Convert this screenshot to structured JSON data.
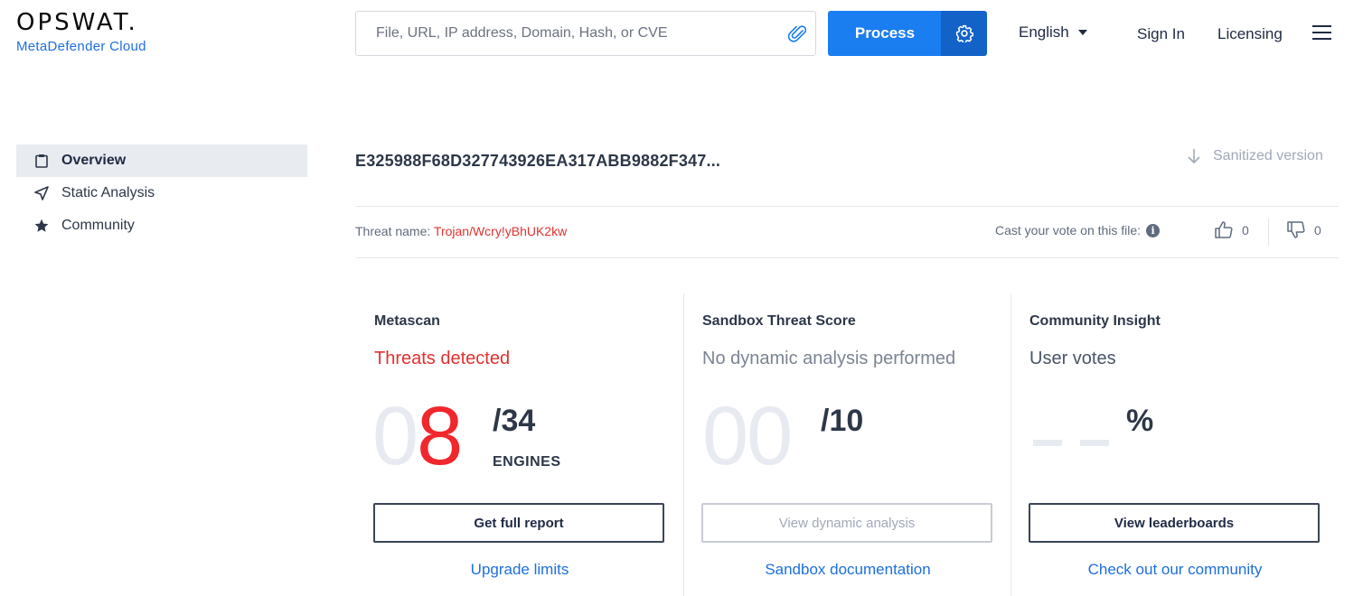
{
  "header": {
    "logo_text": "OPSWAT.",
    "logo_sub": "MetaDefender Cloud",
    "search_placeholder": "File, URL, IP address, Domain, Hash, or CVE",
    "process_label": "Process",
    "language": "English",
    "signin_label": "Sign In",
    "licensing_label": "Licensing"
  },
  "sidebar": {
    "items": [
      {
        "label": "Overview",
        "icon": "clipboard-icon"
      },
      {
        "label": "Static Analysis",
        "icon": "send-icon"
      },
      {
        "label": "Community",
        "icon": "star-icon"
      }
    ]
  },
  "file": {
    "hash": "E325988F68D327743926EA317ABB9882F347...",
    "sanitized_label": "Sanitized version",
    "threat_label": "Threat name:",
    "threat_name": "Trojan/Wcry!yBhUK2kw",
    "vote_label": "Cast your vote on this file:",
    "upvotes": "0",
    "downvotes": "0"
  },
  "cards": {
    "metascan": {
      "title": "Metascan",
      "status": "Threats detected",
      "digit_ghost": "0",
      "digit_value": "8",
      "total": "/34",
      "unit": "ENGINES",
      "button": "Get full report",
      "link": "Upgrade limits"
    },
    "sandbox": {
      "title": "Sandbox Threat Score",
      "status": "No dynamic analysis performed",
      "digits": "00",
      "total": "/10",
      "button": "View dynamic analysis",
      "link": "Sandbox documentation"
    },
    "community": {
      "title": "Community Insight",
      "status": "User votes",
      "total": "%",
      "button": "View leaderboards",
      "link": "Check out our community"
    }
  },
  "colors": {
    "accent": "#1a7df0",
    "accent_dark": "#1262c8",
    "danger": "#e0312f",
    "link": "#1d6fe0"
  }
}
